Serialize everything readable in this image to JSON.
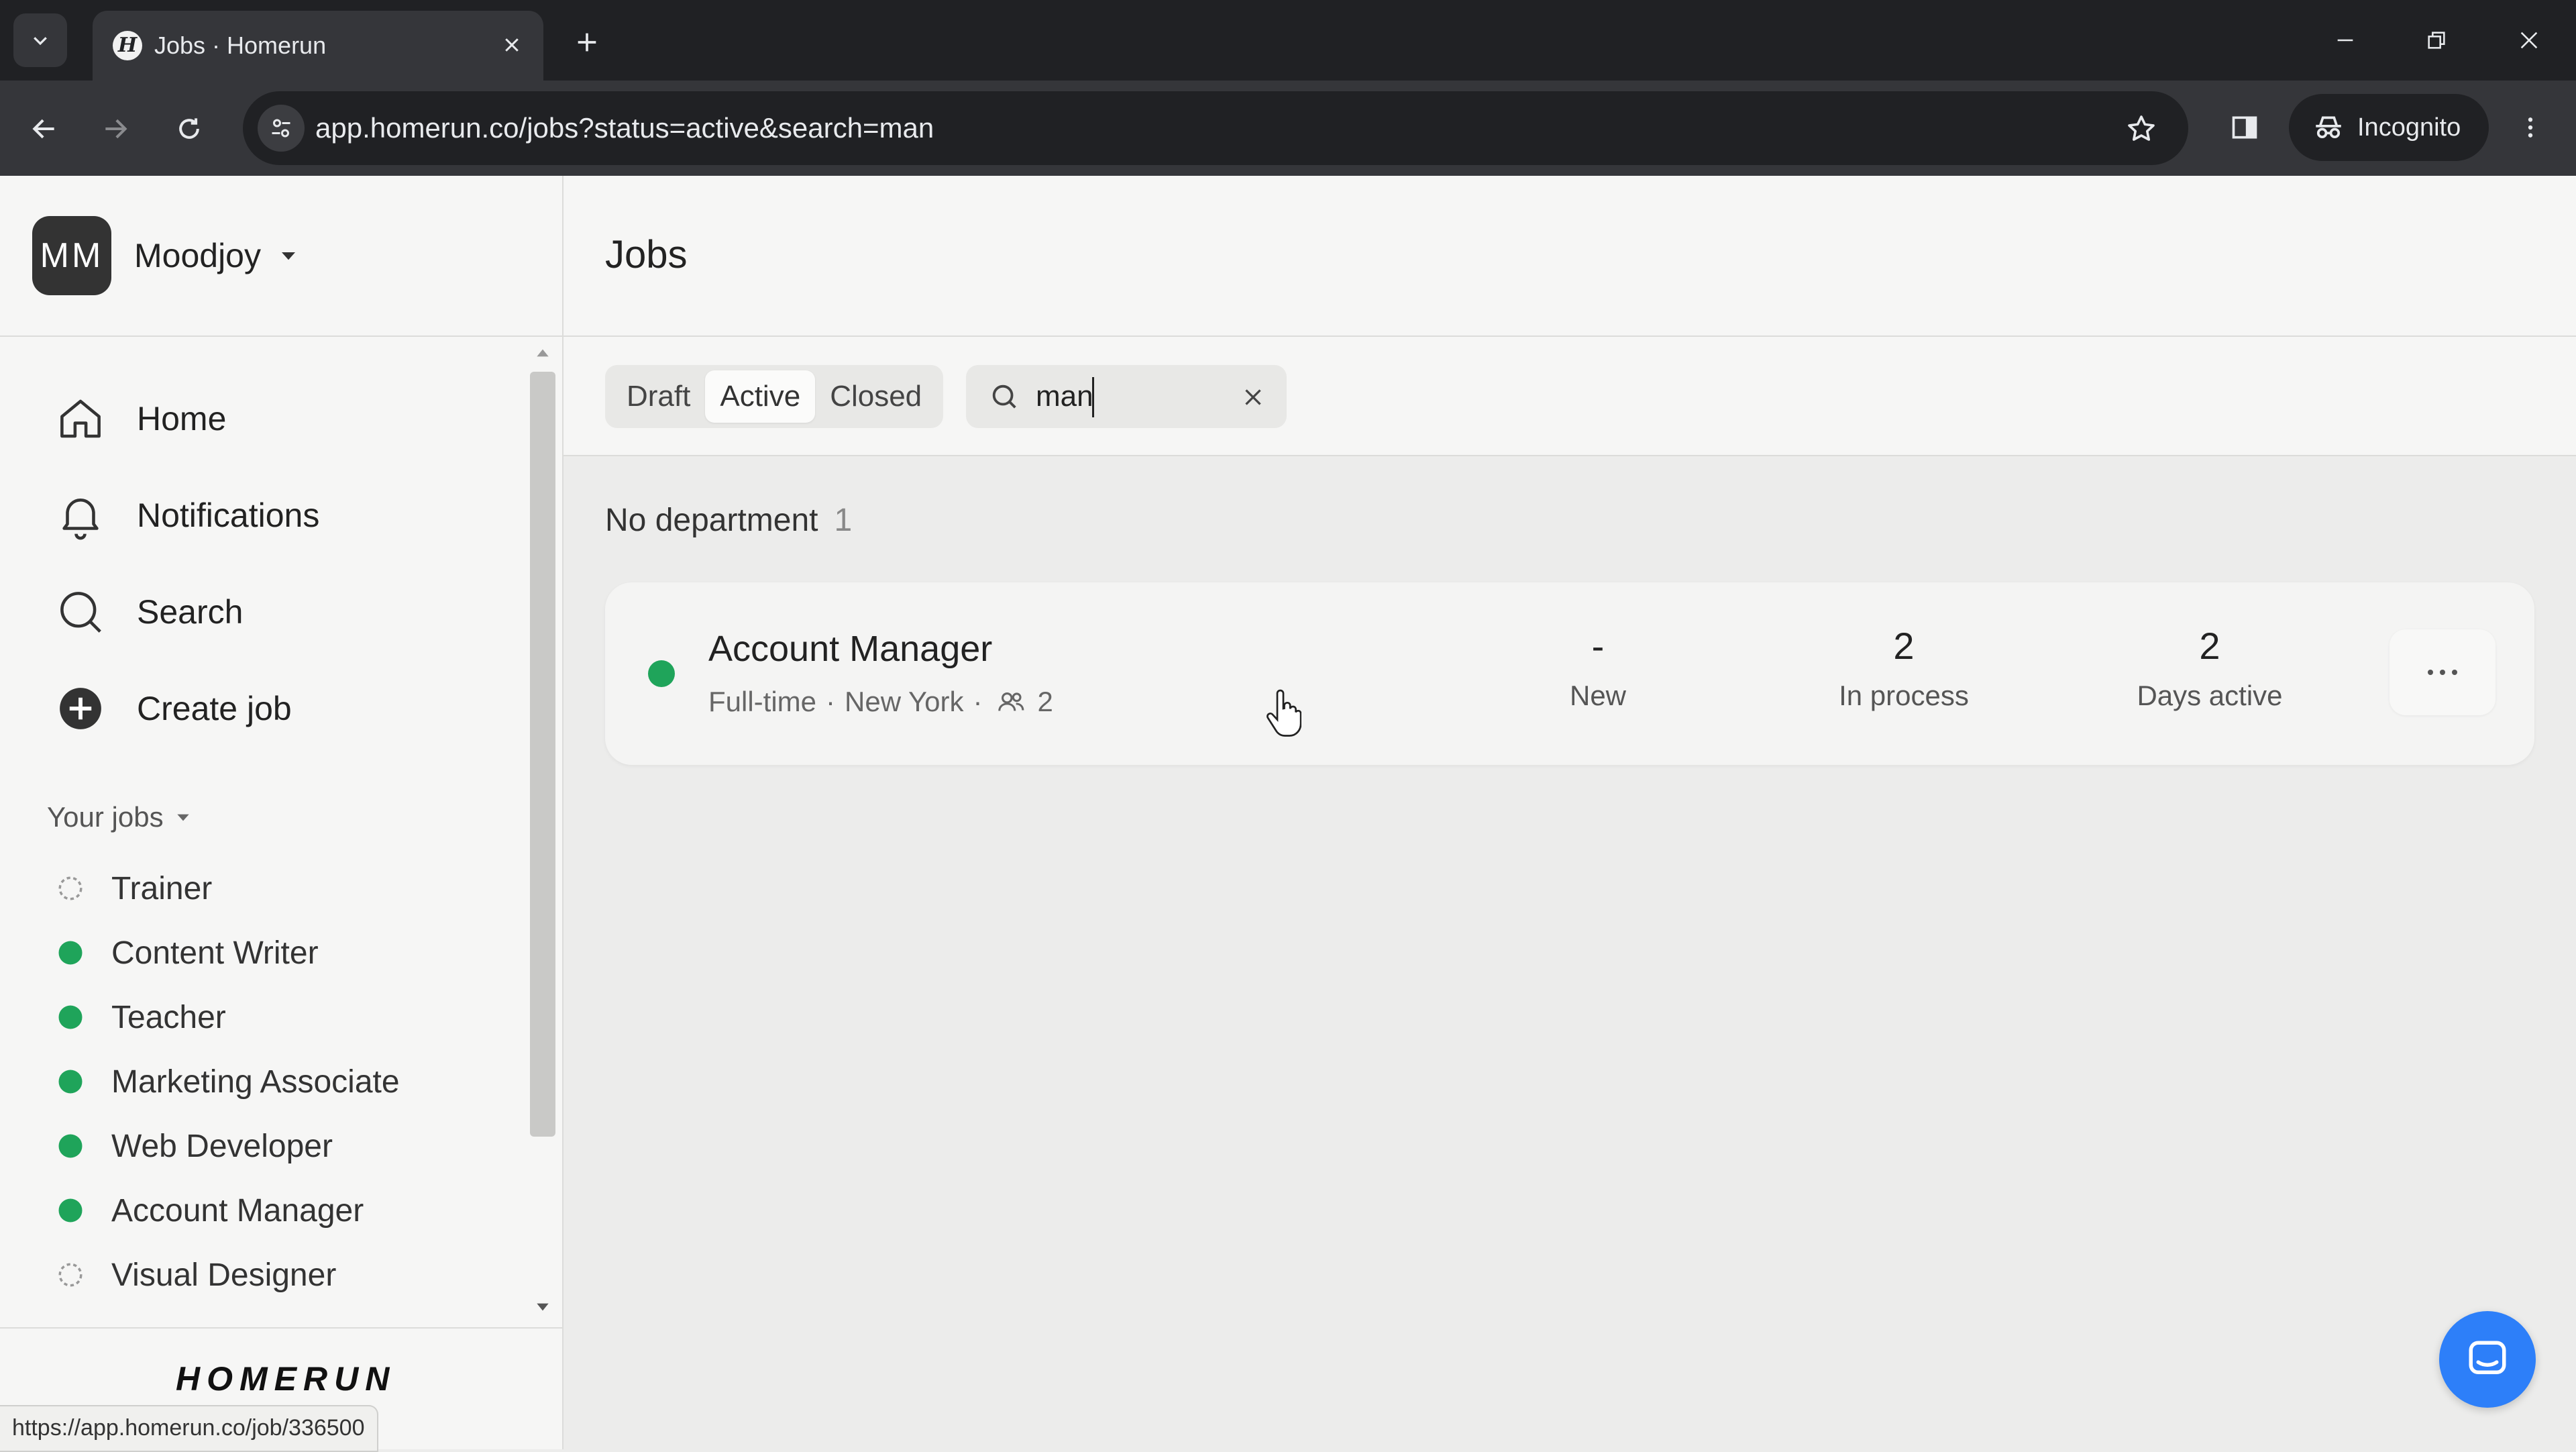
{
  "browser": {
    "tab_title": "Jobs · Homerun",
    "url": "app.homerun.co/jobs?status=active&search=man",
    "incognito_label": "Incognito"
  },
  "sidebar": {
    "org_initials": "MM",
    "org_name": "Moodjoy",
    "nav": [
      {
        "label": "Home",
        "icon": "home-icon"
      },
      {
        "label": "Notifications",
        "icon": "bell-icon"
      },
      {
        "label": "Search",
        "icon": "search-icon"
      },
      {
        "label": "Create job",
        "icon": "plus-circle-icon"
      }
    ],
    "your_jobs_label": "Your jobs",
    "jobs": [
      {
        "label": "Trainer",
        "status": "draft"
      },
      {
        "label": "Content Writer",
        "status": "active"
      },
      {
        "label": "Teacher",
        "status": "active"
      },
      {
        "label": "Marketing Associate",
        "status": "active"
      },
      {
        "label": "Web Developer",
        "status": "active"
      },
      {
        "label": "Account Manager",
        "status": "active"
      },
      {
        "label": "Visual Designer",
        "status": "draft"
      }
    ],
    "brand": "HOMERUN",
    "status_url": "https://app.homerun.co/job/336500"
  },
  "main": {
    "title": "Jobs",
    "filters": [
      {
        "label": "Draft",
        "active": false
      },
      {
        "label": "Active",
        "active": true
      },
      {
        "label": "Closed",
        "active": false
      }
    ],
    "search_value": "man",
    "department": {
      "name": "No department",
      "count": "1"
    },
    "job_card": {
      "title": "Account Manager",
      "type": "Full-time",
      "location": "New York",
      "people": "2",
      "stats": [
        {
          "value": "-",
          "label": "New"
        },
        {
          "value": "2",
          "label": "In process"
        },
        {
          "value": "2",
          "label": "Days active"
        }
      ]
    }
  },
  "colors": {
    "active_green": "#1fa45a",
    "chat_blue": "#2d7ff9",
    "chrome_dark": "#202124"
  }
}
